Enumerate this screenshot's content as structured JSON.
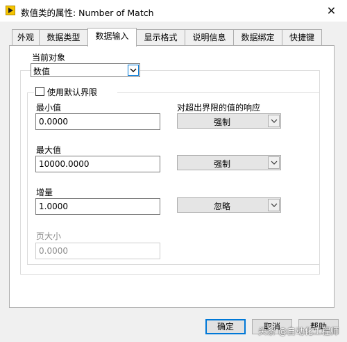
{
  "window": {
    "title": "数值类的属性: Number of Match",
    "close_glyph": "✕"
  },
  "tabs": [
    {
      "label": "外观",
      "active": false
    },
    {
      "label": "数据类型",
      "active": false
    },
    {
      "label": "数据输入",
      "active": true
    },
    {
      "label": "显示格式",
      "active": false
    },
    {
      "label": "说明信息",
      "active": false
    },
    {
      "label": "数据绑定",
      "active": false
    },
    {
      "label": "快捷键",
      "active": false
    }
  ],
  "current_object": {
    "label": "当前对象",
    "value": "数值"
  },
  "use_default_limits": {
    "label": "使用默认界限",
    "checked": false
  },
  "response_header": "对超出界限的值的响应",
  "minimum": {
    "label": "最小值",
    "value": "0.0000",
    "response": "强制"
  },
  "maximum": {
    "label": "最大值",
    "value": "10000.0000",
    "response": "强制"
  },
  "increment": {
    "label": "增量",
    "value": "1.0000",
    "response": "忽略"
  },
  "page_size": {
    "label": "页大小",
    "value": "0.0000",
    "enabled": false
  },
  "buttons": {
    "ok": "确定",
    "cancel": "取消",
    "help": "帮助"
  },
  "watermark": "头条 @自动化工程师",
  "icons": {
    "app": "labview-app-icon",
    "close": "close-icon",
    "dropdown": "chevron-down-icon"
  }
}
